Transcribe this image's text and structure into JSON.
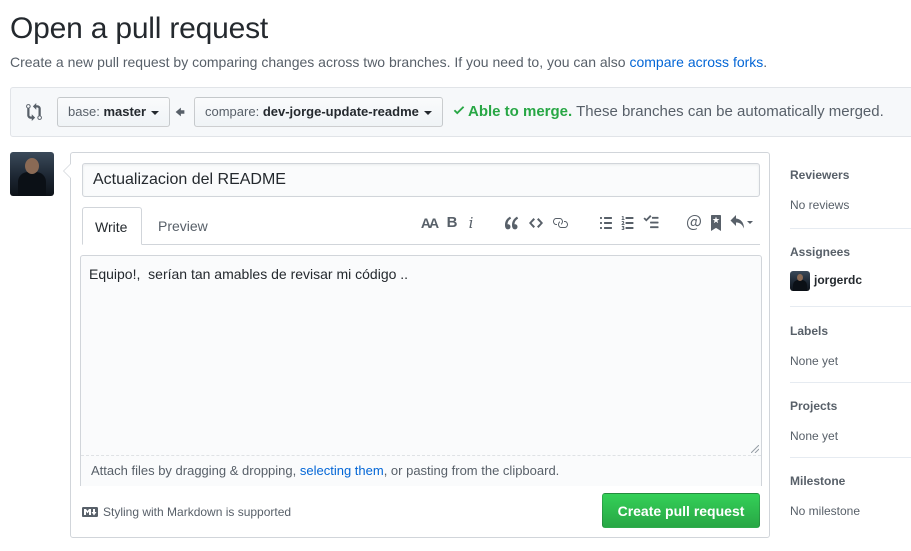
{
  "header": {
    "title": "Open a pull request",
    "subtitle_prefix": "Create a new pull request by comparing changes across two branches. If you need to, you can also",
    "subtitle_link": "compare across forks",
    "subtitle_suffix": "."
  },
  "range": {
    "base_label": "base:",
    "base_value": "master",
    "compare_label": "compare:",
    "compare_value": "dev-jorge-update-readme",
    "merge_ok": "Able to merge.",
    "merge_text": "These branches can be automatically merged."
  },
  "form": {
    "title_value": "Actualizacion del README",
    "tab_write": "Write",
    "tab_preview": "Preview",
    "body_value": "Equipo!,  serían tan amables de revisar mi código ..",
    "drop_prefix": "Attach files by dragging & dropping,",
    "drop_link": "selecting them",
    "drop_suffix": ", or pasting from the clipboard.",
    "markdown_note": "Styling with Markdown is supported",
    "submit_label": "Create pull request"
  },
  "toolbar": {
    "icons": [
      "text-size-icon",
      "bold-icon",
      "italic-icon",
      "quote-icon",
      "code-icon",
      "link-icon",
      "unordered-list-icon",
      "ordered-list-icon",
      "task-list-icon",
      "mention-icon",
      "bookmark-icon",
      "reply-icon"
    ],
    "heading_glyph": "AA",
    "bold_glyph": "B",
    "italic_glyph": "i"
  },
  "sidebar": {
    "reviewers_title": "Reviewers",
    "reviewers_value": "No reviews",
    "assignees_title": "Assignees",
    "assignee_name": "jorgerdc",
    "labels_title": "Labels",
    "labels_value": "None yet",
    "projects_title": "Projects",
    "projects_value": "None yet",
    "milestone_title": "Milestone",
    "milestone_value": "No milestone"
  },
  "colors": {
    "link": "#0366d6",
    "success": "#28a745",
    "muted": "#586069",
    "text": "#24292e"
  }
}
